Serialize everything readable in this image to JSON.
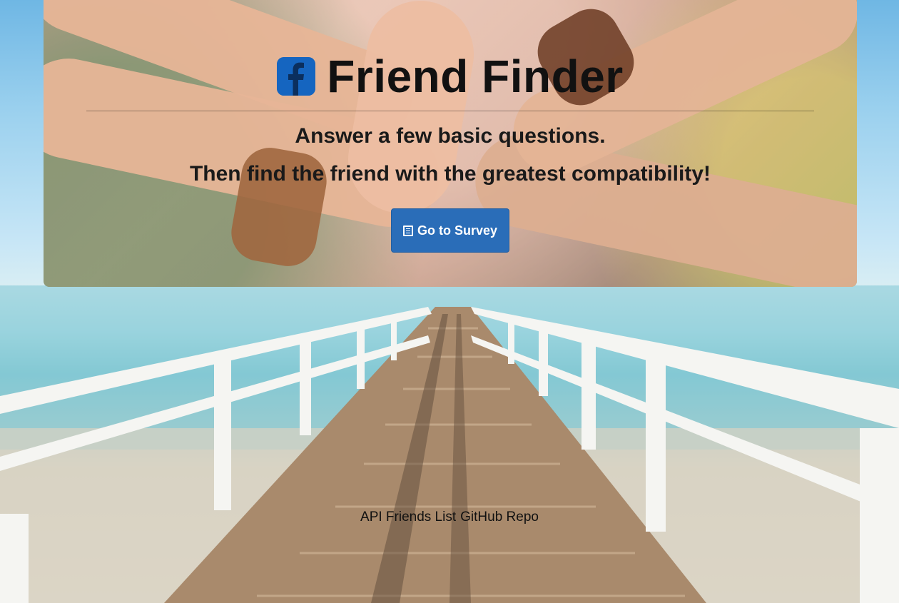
{
  "header": {
    "logo_icon": "facebook-icon",
    "title": "Friend Finder",
    "subtitle_line1": "Answer a few basic questions.",
    "subtitle_line2": "Then find the friend with the greatest compatibility!"
  },
  "cta": {
    "label": "Go to Survey",
    "icon": "list-alt-icon",
    "color": "#2a6db8"
  },
  "footer": {
    "links": [
      "API Friends List",
      "GitHub Repo"
    ]
  }
}
